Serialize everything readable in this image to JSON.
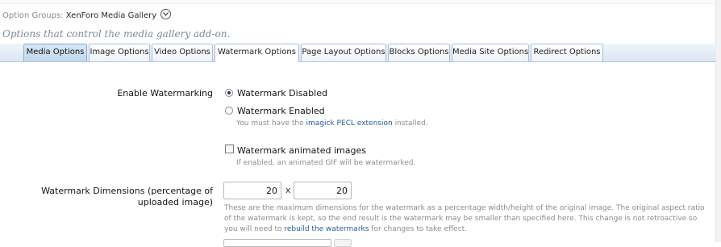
{
  "group": {
    "prefix": "Option Groups:",
    "value": "XenForo Media Gallery",
    "icon": "chevron-down-icon"
  },
  "description": "Options that control the media gallery add-on.",
  "tabs": [
    {
      "label": "Media Options",
      "state": "active"
    },
    {
      "label": "Image Options",
      "state": ""
    },
    {
      "label": "Video Options",
      "state": ""
    },
    {
      "label": "Watermark Options",
      "state": "selected"
    },
    {
      "label": "Page Layout Options",
      "state": ""
    },
    {
      "label": "Blocks Options",
      "state": ""
    },
    {
      "label": "Media Site Options",
      "state": ""
    },
    {
      "label": "Redirect Options",
      "state": ""
    }
  ],
  "enable_watermarking": {
    "label": "Enable Watermarking",
    "disabled_label": "Watermark Disabled",
    "enabled_label": "Watermark Enabled",
    "selected": "disabled",
    "enabled_hint_before": "You must have the",
    "enabled_hint_link": "imagick PECL extension",
    "enabled_hint_after": "installed."
  },
  "animated": {
    "label": "Watermark animated images",
    "checked": false,
    "hint": "If enabled, an animated GIF will be watermarked."
  },
  "dimensions": {
    "label": "Watermark Dimensions (percentage of uploaded image)",
    "width": "20",
    "separator": "x",
    "height": "20",
    "explain_before": "These are the maximum dimensions for the watermark as a percentage width/height of the original image. The original aspect ratio of the watermark is kept, so the end result is the watermark may be smaller than specified here. This change is not retroactive so you will need to",
    "explain_link": "rebuild the watermarks",
    "explain_after": "for changes to take effect."
  }
}
